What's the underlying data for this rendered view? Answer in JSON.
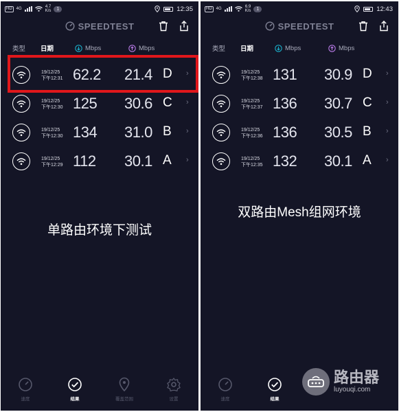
{
  "colors": {
    "background": "#141526",
    "highlight": "#e0171b",
    "muted": "#7f8194",
    "download": "#1aaec9",
    "upload": "#b87ae6"
  },
  "panels": [
    {
      "status": {
        "hd": "HD",
        "net": "4G",
        "speed_value": "4.7",
        "speed_unit": "K/s",
        "notif": "1",
        "time": "12:35"
      },
      "brand": "SPEEDTEST",
      "header": {
        "type": "类型",
        "date": "日期",
        "download": "Mbps",
        "upload": "Mbps"
      },
      "rows": [
        {
          "date": "19/12/25",
          "time": "下午12:31",
          "download": "62.2",
          "upload": "21.4",
          "server": "D"
        },
        {
          "date": "19/12/25",
          "time": "下午12:30",
          "download": "125",
          "upload": "30.6",
          "server": "C"
        },
        {
          "date": "19/12/25",
          "time": "下午12:30",
          "download": "134",
          "upload": "31.0",
          "server": "B"
        },
        {
          "date": "19/12/25",
          "time": "下午12:29",
          "download": "112",
          "upload": "30.1",
          "server": "A"
        }
      ],
      "caption": "单路由环境下测试",
      "nav": [
        {
          "label": "速度",
          "icon": "speedometer-icon"
        },
        {
          "label": "结果",
          "icon": "check-circle-icon"
        },
        {
          "label": "覆盖范围",
          "icon": "location-pin-icon"
        },
        {
          "label": "设置",
          "icon": "gear-icon"
        }
      ]
    },
    {
      "status": {
        "hd": "HD",
        "net": "4G",
        "speed_value": "6.9",
        "speed_unit": "K/s",
        "notif": "1",
        "time": "12:43"
      },
      "brand": "SPEEDTEST",
      "header": {
        "type": "类型",
        "date": "日期",
        "download": "Mbps",
        "upload": "Mbps"
      },
      "rows": [
        {
          "date": "19/12/25",
          "time": "下午12:38",
          "download": "131",
          "upload": "30.9",
          "server": "D"
        },
        {
          "date": "19/12/25",
          "time": "下午12:37",
          "download": "136",
          "upload": "30.7",
          "server": "C"
        },
        {
          "date": "19/12/25",
          "time": "下午12:36",
          "download": "136",
          "upload": "30.5",
          "server": "B"
        },
        {
          "date": "19/12/25",
          "time": "下午12:35",
          "download": "132",
          "upload": "30.1",
          "server": "A"
        }
      ],
      "caption": "双路由Mesh组网环境",
      "nav": [
        {
          "label": "速度",
          "icon": "speedometer-icon"
        },
        {
          "label": "结果",
          "icon": "check-circle-icon"
        }
      ]
    }
  ],
  "watermark": {
    "brand": "路由器",
    "site": "luyouqi.com"
  }
}
